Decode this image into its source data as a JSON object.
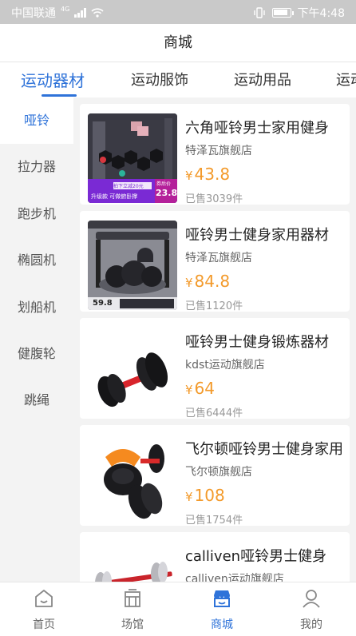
{
  "status_bar": {
    "carrier": "中国联通",
    "network": "4G",
    "time": "下午4:48"
  },
  "header": {
    "title": "商城"
  },
  "category_tabs": [
    "运动器材",
    "运动服饰",
    "运动用品",
    "运动"
  ],
  "active_category_tab": 0,
  "sidebar": {
    "items": [
      "哑铃",
      "拉力器",
      "跑步机",
      "椭圆机",
      "划船机",
      "健腹轮",
      "跳绳"
    ],
    "active": 0
  },
  "products": [
    {
      "title": "六角哑铃男士家用健身",
      "shop": "特泽瓦旗舰店",
      "currency": "¥",
      "price": "43.8",
      "sold": "已售3039件",
      "img_badge_top": "拍下立减20元",
      "img_badge_left": "升级款 可做俯卧撑",
      "img_badge_right_label": "券后价",
      "img_badge_right_price": "23.8"
    },
    {
      "title": "哑铃男士健身家用器材",
      "shop": "特泽瓦旗舰店",
      "currency": "¥",
      "price": "84.8",
      "sold": "已售1120件",
      "img_badge_price": "59.8"
    },
    {
      "title": "哑铃男士健身锻炼器材",
      "shop": "kdst运动旗舰店",
      "currency": "¥",
      "price": "64",
      "sold": "已售6444件"
    },
    {
      "title": "飞尔顿哑铃男士健身家用",
      "shop": "飞尔顿旗舰店",
      "currency": "¥",
      "price": "108",
      "sold": "已售1754件"
    },
    {
      "title": "calliven哑铃男士健身",
      "shop": "calliven运动旗舰店",
      "currency": "¥",
      "price": "",
      "sold": ""
    }
  ],
  "bottom_nav": {
    "items": [
      "首页",
      "场馆",
      "商城",
      "我的"
    ],
    "active": 2
  },
  "colors": {
    "accent": "#2f73d9",
    "price": "#f39a2b",
    "sidebar_bg": "#f3f3f3",
    "status_bar_bg": "#c9c9c9"
  },
  "icons": [
    "signal-icon",
    "wifi-icon",
    "vibrate-icon",
    "battery-icon",
    "home-icon",
    "venue-icon",
    "store-icon",
    "profile-icon"
  ]
}
